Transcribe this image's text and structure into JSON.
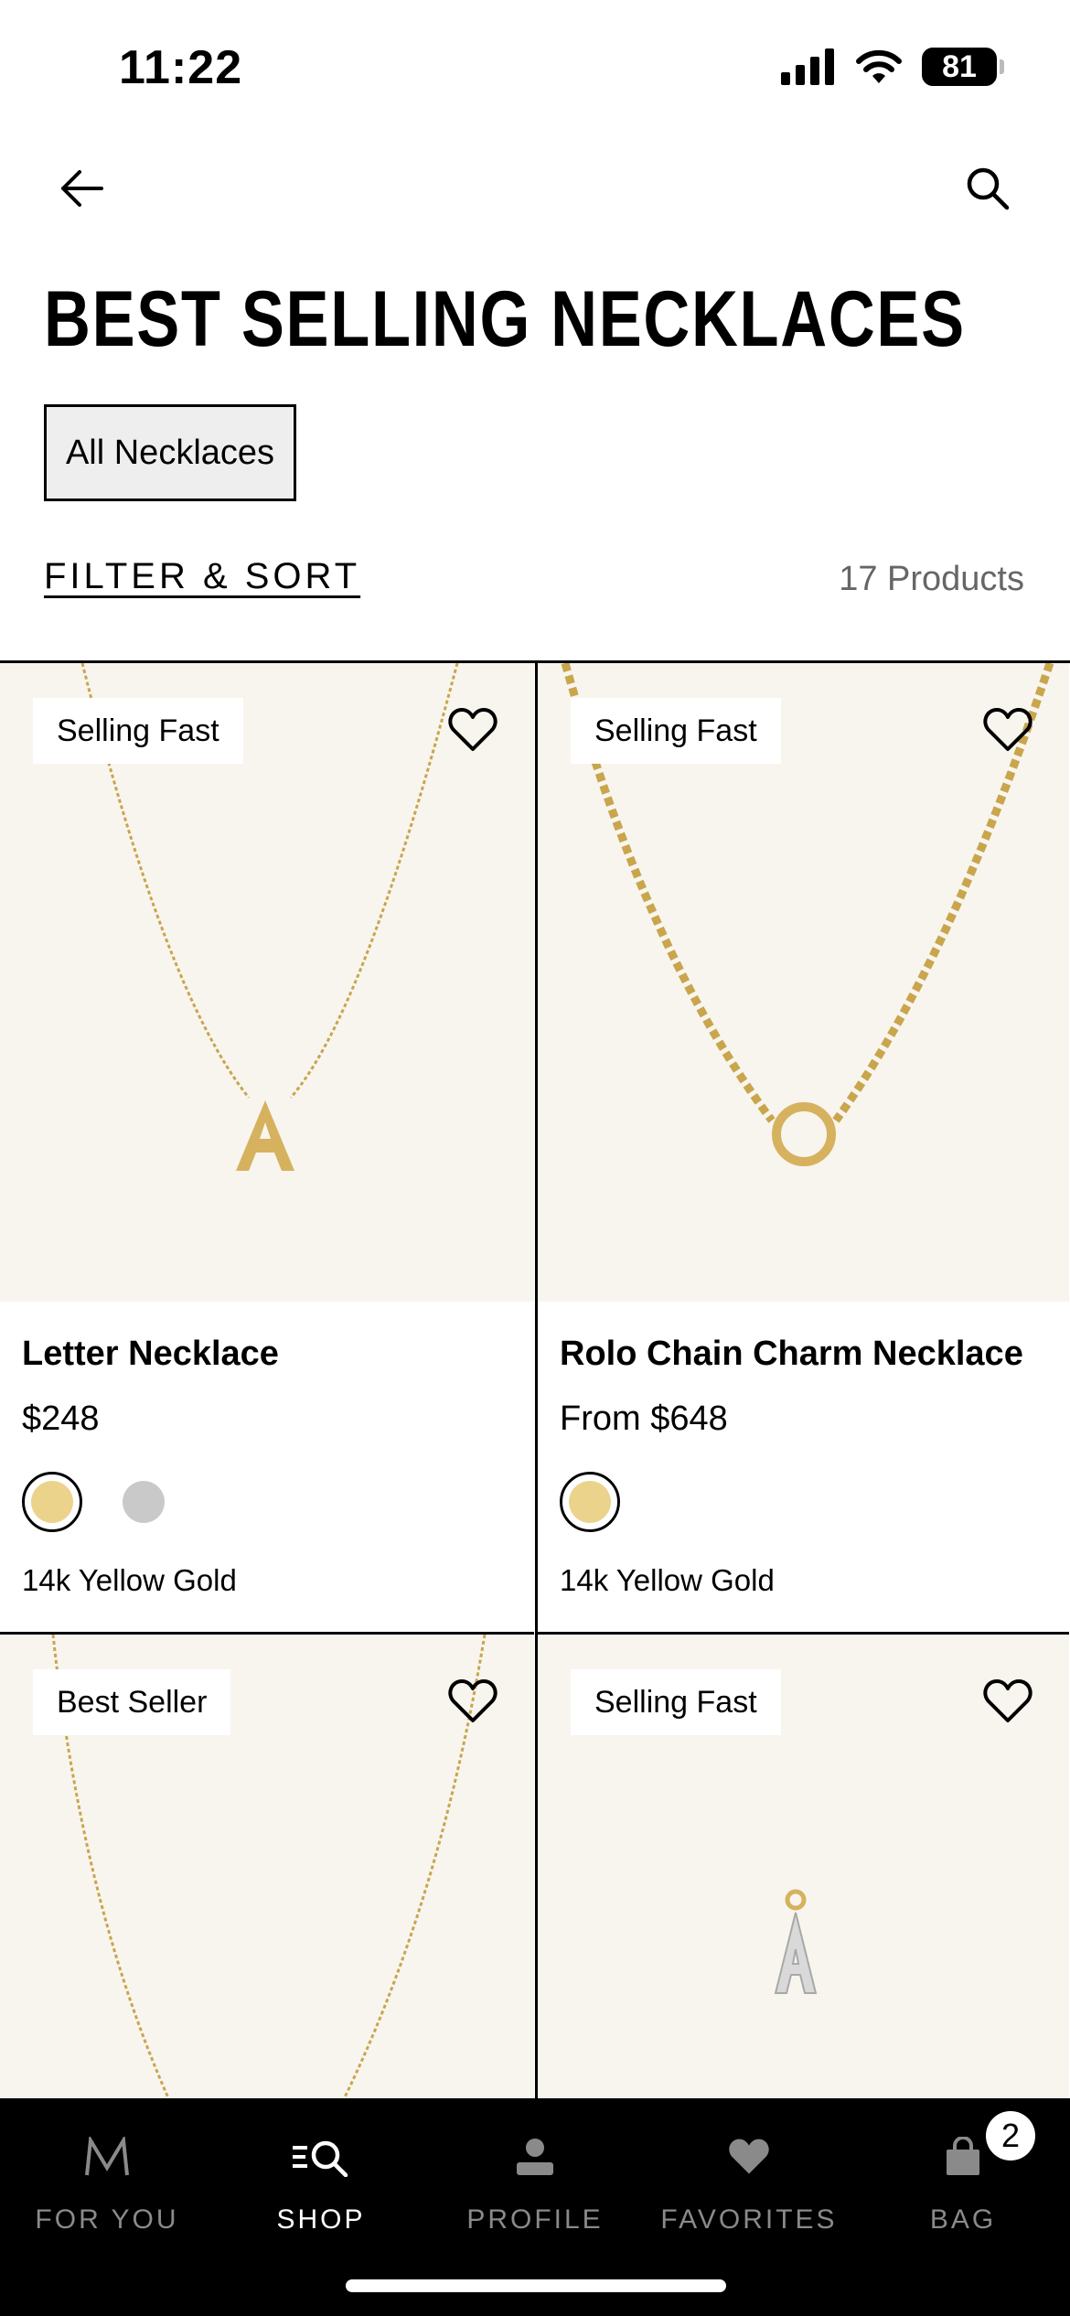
{
  "status": {
    "time": "11:22",
    "battery": "81"
  },
  "header": {
    "title": "BEST SELLING NECKLACES",
    "chip": "All Necklaces",
    "filter_label": "FILTER & SORT",
    "count": "17 Products"
  },
  "products": [
    {
      "badge": "Selling Fast",
      "name": "Letter Necklace",
      "price": "$248",
      "metal": "14k Yellow Gold",
      "swatches": [
        "#ecd38c",
        "#c9c9c9"
      ]
    },
    {
      "badge": "Selling Fast",
      "name": "Rolo Chain Charm Necklace",
      "price": "From $648",
      "metal": "14k Yellow Gold",
      "swatches": [
        "#ecd38c"
      ]
    },
    {
      "badge": "Best Seller"
    },
    {
      "badge": "Selling Fast"
    }
  ],
  "tabs": [
    {
      "label": "FOR YOU",
      "icon": "monogram-m-icon"
    },
    {
      "label": "SHOP",
      "icon": "shop-search-icon"
    },
    {
      "label": "PROFILE",
      "icon": "person-icon"
    },
    {
      "label": "FAVORITES",
      "icon": "heart-icon"
    },
    {
      "label": "BAG",
      "icon": "bag-icon",
      "badge": "2"
    }
  ]
}
